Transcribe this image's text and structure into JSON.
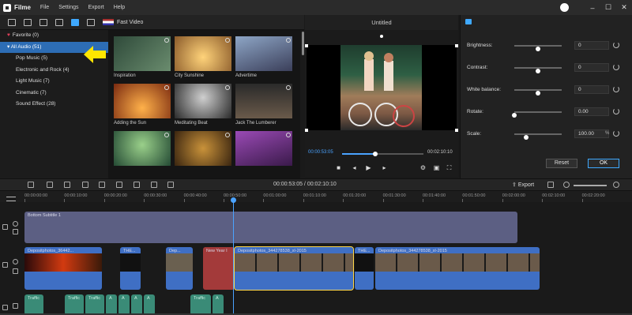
{
  "app": {
    "name": "Filme",
    "menu": [
      "File",
      "Settings",
      "Export",
      "Help"
    ]
  },
  "media": {
    "fast_video_label": "Fast Video",
    "sidebar": [
      {
        "label": "Favorite (0)"
      },
      {
        "label": "All Audio (51)"
      },
      {
        "label": "Pop Music (5)"
      },
      {
        "label": "Electronic and Rock (4)"
      },
      {
        "label": "Light Music (7)"
      },
      {
        "label": "Cinematic (7)"
      },
      {
        "label": "Sound Effect (28)"
      }
    ],
    "tiles": [
      {
        "label": "Inspiration",
        "color": "#3b5a4a"
      },
      {
        "label": "City Sunshine",
        "color": "#b07a40"
      },
      {
        "label": "Advertime",
        "color": "#6b7fa0"
      },
      {
        "label": "Adding the Sun",
        "color": "#c65a2c"
      },
      {
        "label": "Meditating Beat",
        "color": "#777777"
      },
      {
        "label": "Jack The Lumberer",
        "color": "#5a4a3a"
      },
      {
        "label": "",
        "color": "#3f7a5a"
      },
      {
        "label": "",
        "color": "#8a5a2a"
      },
      {
        "label": "",
        "color": "#6a3a7a"
      }
    ]
  },
  "preview": {
    "title": "Untitled",
    "current_time": "00:00:53:05",
    "total_time": "00:02:10:10",
    "progress": 0.41
  },
  "properties": {
    "rows": [
      {
        "label": "Brightness:",
        "value": "0",
        "unit": "",
        "level": 0.5
      },
      {
        "label": "Contrast:",
        "value": "0",
        "unit": "",
        "level": 0.5
      },
      {
        "label": "White balance:",
        "value": "0",
        "unit": "",
        "level": 0.5
      },
      {
        "label": "Rotate:",
        "value": "0.00",
        "unit": "",
        "level": 0.0
      },
      {
        "label": "Scale:",
        "value": "100.00",
        "unit": "%",
        "level": 0.25
      }
    ],
    "reset_label": "Reset",
    "ok_label": "OK"
  },
  "timeline": {
    "timecode": "00:00:53:05 / 00:02:10:10",
    "export_label": "Export",
    "ruler": [
      "00:00:00:00",
      "00:00:10:00",
      "00:00:20:00",
      "00:00:30:00",
      "00:00:40:00",
      "00:00:50:00",
      "00:01:00:00",
      "00:01:10:00",
      "00:01:20:00",
      "00:01:30:00",
      "00:01:40:00",
      "00:01:50:00",
      "00:02:00:00",
      "00:02:10:00",
      "00:02:20:00"
    ],
    "subtitle_clip": "Bottom Subtitle 1",
    "video_clips": [
      {
        "title": "Depositphotos_36442..."
      },
      {
        "title": "THE..."
      },
      {
        "title": "Dep..."
      },
      {
        "title": "New Year I"
      },
      {
        "title": "Depositphotos_344278538_xl-2015"
      },
      {
        "title": "THE..."
      },
      {
        "title": "Depositphotos_344278538_xl-2015"
      }
    ],
    "audio_clips": [
      "Traffic",
      "Traffic",
      "Traffic",
      "A",
      "A",
      "A",
      "A",
      "Traffic",
      "A"
    ]
  }
}
